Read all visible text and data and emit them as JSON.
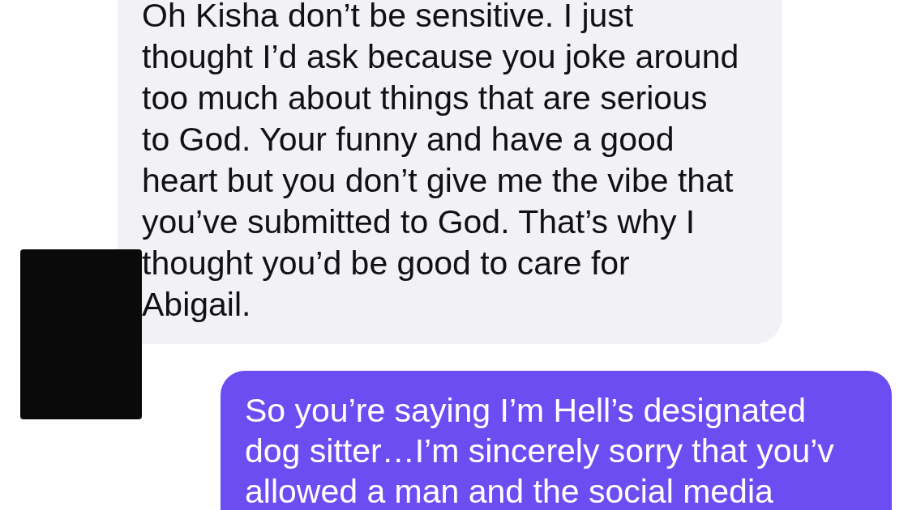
{
  "messages": [
    {
      "kind": "incoming",
      "lines": [
        "Oh Kisha don’t be sensitive. I just",
        "thought I’d ask because you joke around",
        "too much about things that are serious",
        "to God. Your funny and have a good",
        "heart but you don’t give me the vibe that",
        "you’ve submitted to God. That’s why I",
        "thought you’d be good to care for",
        "Abigail."
      ]
    },
    {
      "kind": "outgoing",
      "lines": [
        "So you’re saying I’m Hell’s designated",
        "dog sitter…I’m sincerely sorry that you’v",
        "allowed a man and the social media"
      ]
    }
  ]
}
